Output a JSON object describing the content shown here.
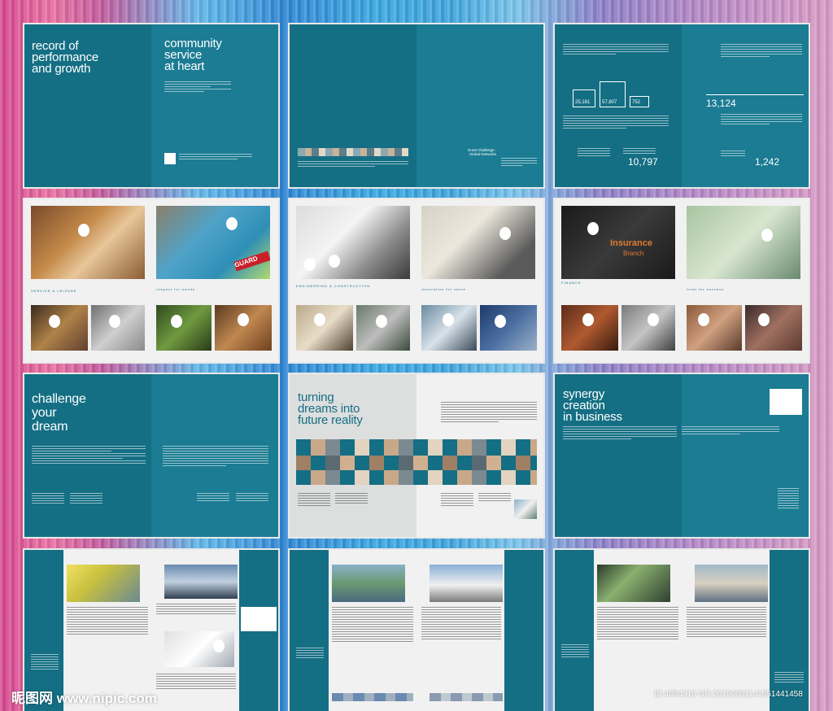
{
  "spread1": {
    "title_left": [
      "record of",
      "performance",
      "and growth"
    ],
    "title_right": [
      "community",
      "service",
      "at heart"
    ]
  },
  "spread2": {
    "label": [
      "Great Challenge :",
      "Global Networks"
    ]
  },
  "spread3": {
    "stat1": "25,161",
    "stat2": "57,807",
    "stat3": "752",
    "big1": "13,124",
    "big2": "10,797",
    "big3": "1,242"
  },
  "spread4": {
    "caption": "respect for needs"
  },
  "spread5": {
    "caption": "innovation for value"
  },
  "spread6": {
    "caption": "trust for success",
    "sign": "Insurance",
    "sign2": "Branch"
  },
  "spread7": {
    "title": [
      "challenge",
      "your",
      "dream"
    ]
  },
  "spread8": {
    "title": [
      "turning",
      "dreams into",
      "future reality"
    ]
  },
  "spread9": {
    "title": [
      "synergy",
      "creation",
      "in business"
    ]
  },
  "watermark": {
    "left": "昵图网 www.nipic.com",
    "right": "ID:4654310 NO:20150601141651441458"
  },
  "colors": {
    "teal": "#146f84",
    "grey": "#dddede"
  }
}
